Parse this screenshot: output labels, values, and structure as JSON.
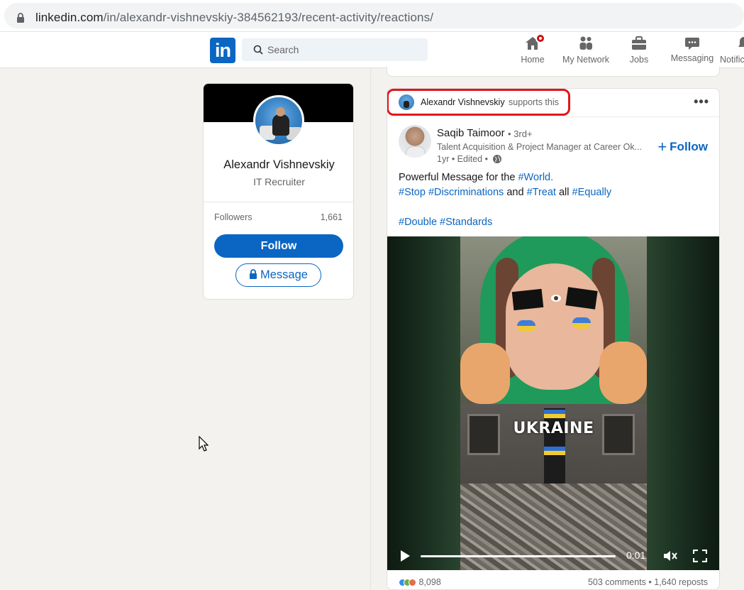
{
  "browser": {
    "url_host": "linkedin.com",
    "url_path": "/in/alexandr-vishnevskiy-384562193/recent-activity/reactions/"
  },
  "nav": {
    "logo": "in",
    "search_placeholder": "Search",
    "items": [
      {
        "label": "Home",
        "icon": "home-icon"
      },
      {
        "label": "My Network",
        "icon": "network-icon"
      },
      {
        "label": "Jobs",
        "icon": "briefcase-icon"
      },
      {
        "label": "Messaging",
        "icon": "messaging-icon"
      },
      {
        "label": "Notific",
        "icon": "bell-icon"
      }
    ]
  },
  "profile_card": {
    "name": "Alexandr Vishnevskiy",
    "title": "IT Recruiter",
    "followers_label": "Followers",
    "followers_count": "1,661",
    "follow_label": "Follow",
    "message_label": "Message"
  },
  "post": {
    "supporter_name": "Alexandr Vishnevskiy",
    "supporter_action": "supports this",
    "author": {
      "name": "Saqib Taimoor",
      "degree": "• 3rd+",
      "headline": "Talent Acquisition & Project Manager at Career Ok...",
      "meta": "1yr • Edited •"
    },
    "follow_label": "Follow",
    "text_line1_plain": "Powerful Message for the ",
    "text_line1_tag": "#World.",
    "tag_stop": "#Stop",
    "tag_discriminations": "#Discriminations",
    "word_and": "and",
    "tag_treat": "#Treat",
    "word_all": "all",
    "tag_equally": "#Equally",
    "tag_double": "#Double",
    "tag_standards": "#Standards",
    "video": {
      "overlay_text": "UKRAINE",
      "time": "0:01",
      "progress": 0.02
    },
    "reaction_count": "8,098",
    "comments": "503 comments",
    "reposts": "1,640 reposts",
    "stats_separator": " • "
  },
  "colors": {
    "brand": "#0a66c2",
    "highlight": "#e0161c"
  }
}
